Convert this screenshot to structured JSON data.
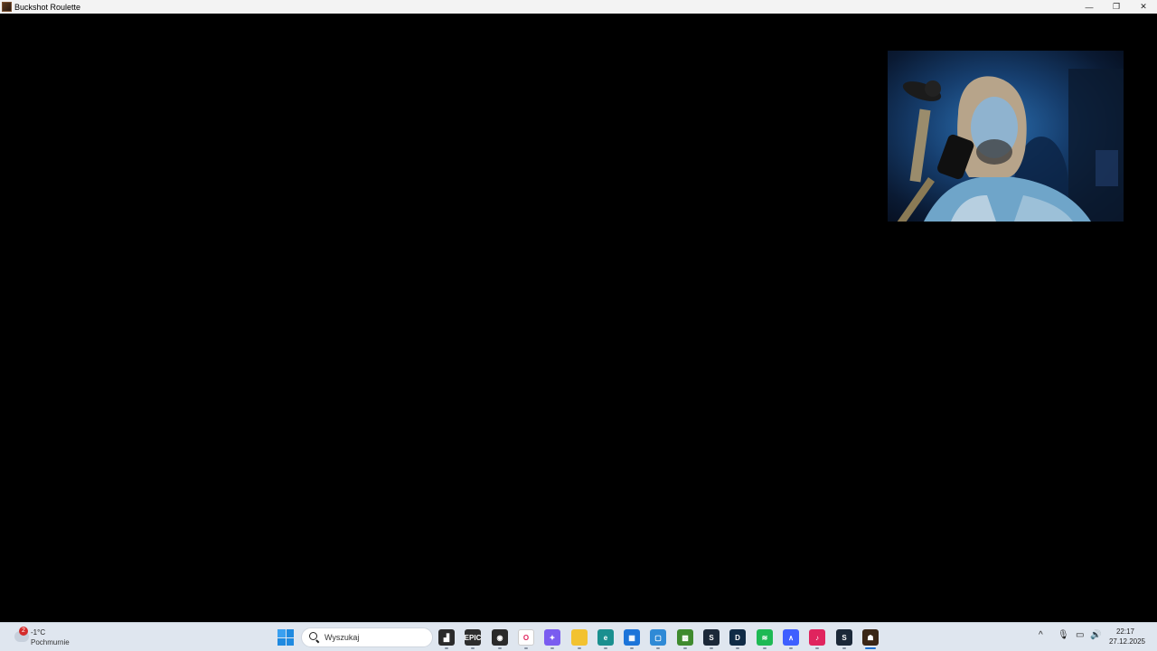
{
  "window": {
    "title": "Buckshot Roulette",
    "controls": {
      "minimize": "—",
      "restore": "❐",
      "close": "✕"
    }
  },
  "game": {
    "state": "black-screen"
  },
  "webcam": {
    "label": ""
  },
  "taskbar": {
    "weather": {
      "badge": "2",
      "temp": "-1°C",
      "desc": "Pochmurnie"
    },
    "search": {
      "placeholder": "Wyszukaj"
    },
    "apps": [
      {
        "name": "task-view",
        "color": "#2b2b2b",
        "glyph": "▟"
      },
      {
        "name": "epic-games",
        "color": "#2d2d2d",
        "glyph": "EPIC"
      },
      {
        "name": "obs",
        "color": "#2a2a2a",
        "glyph": "◉"
      },
      {
        "name": "opera",
        "color": "#ffffff",
        "glyph": "O"
      },
      {
        "name": "copilot",
        "color": "#7a5cf0",
        "glyph": "✦"
      },
      {
        "name": "file-explorer",
        "color": "#f2c230",
        "glyph": ""
      },
      {
        "name": "edge",
        "color": "#1a8f8f",
        "glyph": "e"
      },
      {
        "name": "microsoft-store",
        "color": "#1c74d9",
        "glyph": "▦"
      },
      {
        "name": "notepad",
        "color": "#2f8ad6",
        "glyph": "▢"
      },
      {
        "name": "minecraft",
        "color": "#3f8a2e",
        "glyph": "▩"
      },
      {
        "name": "steam",
        "color": "#1b2838",
        "glyph": "S"
      },
      {
        "name": "deepl",
        "color": "#0f2b46",
        "glyph": "D"
      },
      {
        "name": "spotify",
        "color": "#1db954",
        "glyph": "≋"
      },
      {
        "name": "nordvpn",
        "color": "#3e5fff",
        "glyph": "∧"
      },
      {
        "name": "tiktok",
        "color": "#e0245e",
        "glyph": "♪"
      },
      {
        "name": "steam-2",
        "color": "#1b2838",
        "glyph": "S"
      },
      {
        "name": "buckshot-roulette",
        "color": "#3a2616",
        "glyph": "☗"
      }
    ],
    "tray": {
      "chevron": "^",
      "mic": "🎙",
      "network": "▭",
      "volume": "🔊"
    },
    "clock": {
      "time": "22:17",
      "date": "27.12.2025"
    }
  }
}
